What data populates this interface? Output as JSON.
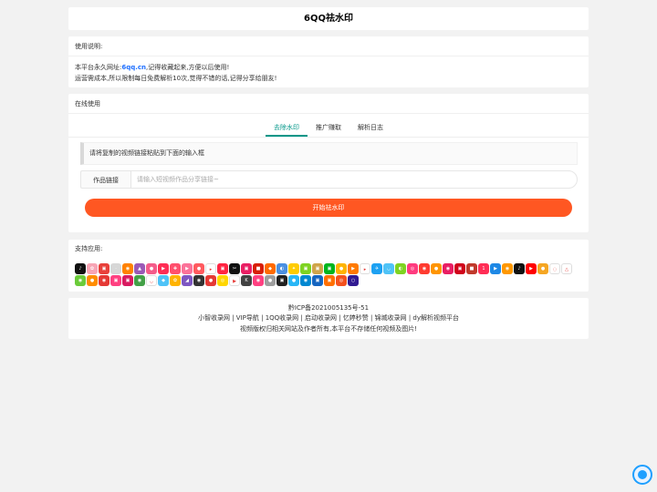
{
  "header": {
    "title": "6QQ祛水印"
  },
  "usage": {
    "heading": "使用说明:",
    "line1_prefix": "本平台永久网址:",
    "line1_site": "6qq.cn",
    "line1_suffix": ",记得收藏起来,方便以后使用!",
    "line2": "运营需成本,所以限制每日免费解析10次,觉得不错的话,记得分享给朋友!"
  },
  "online": {
    "heading": "在线使用",
    "tabs": [
      {
        "label": "去除水印",
        "active": true
      },
      {
        "label": "推广赚取",
        "active": false
      },
      {
        "label": "解析日志",
        "active": false
      }
    ],
    "hint": "请将复制的视频链接粘贴到下面的输入框",
    "field_label": "作品链接",
    "field_placeholder": "请输入短视频作品分享链接~",
    "field_value": "",
    "submit_label": "开始祛水印",
    "accent_color": "#ff5722",
    "tab_active_color": "#009688"
  },
  "apps": {
    "heading": "支持应用:",
    "icons": [
      {
        "name": "douyin-icon",
        "color": "#111111",
        "glyph": "♪"
      },
      {
        "name": "app-icon-2",
        "color": "#f7a5b5",
        "glyph": "✿"
      },
      {
        "name": "app-icon-3",
        "color": "#e8403a",
        "glyph": "▣"
      },
      {
        "name": "app-icon-4",
        "color": "#d7d7d7",
        "glyph": "·"
      },
      {
        "name": "weibo-icon",
        "color": "#ff8200",
        "glyph": "◉"
      },
      {
        "name": "app-icon-6",
        "color": "#9b59b6",
        "glyph": "▲"
      },
      {
        "name": "app-icon-7",
        "color": "#f45c8a",
        "glyph": "●"
      },
      {
        "name": "app-icon-8",
        "color": "#ff2d55",
        "glyph": "▶"
      },
      {
        "name": "app-icon-9",
        "color": "#ff4f6d",
        "glyph": "✚"
      },
      {
        "name": "app-icon-10",
        "color": "#fb7299",
        "glyph": "▶"
      },
      {
        "name": "app-icon-11",
        "color": "#ff5a5f",
        "glyph": "●"
      },
      {
        "name": "app-icon-12",
        "color": "#ffffff",
        "glyph": "▸"
      },
      {
        "name": "app-icon-13",
        "color": "#ff2442",
        "glyph": "▣"
      },
      {
        "name": "app-icon-14",
        "color": "#111111",
        "glyph": "✂"
      },
      {
        "name": "app-icon-15",
        "color": "#e91e63",
        "glyph": "▣"
      },
      {
        "name": "app-icon-16",
        "color": "#d81e06",
        "glyph": "■"
      },
      {
        "name": "app-icon-17",
        "color": "#ff6a00",
        "glyph": "◆"
      },
      {
        "name": "app-icon-18",
        "color": "#4a90e2",
        "glyph": "◐"
      },
      {
        "name": "app-icon-19",
        "color": "#ffcc00",
        "glyph": "✦"
      },
      {
        "name": "app-icon-20",
        "color": "#7ed321",
        "glyph": "▣"
      },
      {
        "name": "app-icon-21",
        "color": "#cfa54a",
        "glyph": "▣"
      },
      {
        "name": "app-icon-22",
        "color": "#00b51d",
        "glyph": "▣"
      },
      {
        "name": "app-icon-23",
        "color": "#ffb400",
        "glyph": "●"
      },
      {
        "name": "app-icon-24",
        "color": "#ff7a00",
        "glyph": "▶"
      },
      {
        "name": "app-icon-25",
        "color": "#ffffff",
        "glyph": "▸"
      },
      {
        "name": "twitter-icon",
        "color": "#1da1f2",
        "glyph": "✈"
      },
      {
        "name": "app-icon-27",
        "color": "#4fc3f7",
        "glyph": "◡"
      },
      {
        "name": "app-icon-28",
        "color": "#7ed321",
        "glyph": "◐"
      },
      {
        "name": "app-icon-29",
        "color": "#ff3b7f",
        "glyph": "◎"
      },
      {
        "name": "app-icon-30",
        "color": "#ff3b30",
        "glyph": "◉"
      },
      {
        "name": "app-icon-31",
        "color": "#ff9500",
        "glyph": "●"
      },
      {
        "name": "app-icon-32",
        "color": "#e91e63",
        "glyph": "◉"
      },
      {
        "name": "app-icon-33",
        "color": "#d0021b",
        "glyph": "▣"
      },
      {
        "name": "app-icon-34",
        "color": "#c0392b",
        "glyph": "■"
      },
      {
        "name": "app-icon-35",
        "color": "#ff2d55",
        "glyph": "1"
      },
      {
        "name": "app-icon-36",
        "color": "#1e88e5",
        "glyph": "▶"
      },
      {
        "name": "app-icon-37",
        "color": "#ff9800",
        "glyph": "◉"
      },
      {
        "name": "app-icon-38",
        "color": "#111111",
        "glyph": "♪"
      },
      {
        "name": "app-icon-39",
        "color": "#ff0000",
        "glyph": "▶"
      },
      {
        "name": "app-icon-40",
        "color": "#f5a623",
        "glyph": "●"
      },
      {
        "name": "app-icon-41",
        "color": "#ffffff",
        "glyph": "◌"
      },
      {
        "name": "app-icon-42",
        "color": "#ffffff",
        "glyph": "△"
      },
      {
        "name": "app-icon-43",
        "color": "#6bcb3a",
        "glyph": "◉"
      },
      {
        "name": "app-icon-44",
        "color": "#ff8c00",
        "glyph": "●"
      },
      {
        "name": "app-icon-45",
        "color": "#e53935",
        "glyph": "◉"
      },
      {
        "name": "app-icon-46",
        "color": "#ff4081",
        "glyph": "▣"
      },
      {
        "name": "app-icon-47",
        "color": "#d81b60",
        "glyph": "▣"
      },
      {
        "name": "app-icon-48",
        "color": "#43a047",
        "glyph": "◉"
      },
      {
        "name": "app-icon-49",
        "color": "#ffffff",
        "glyph": "◡"
      },
      {
        "name": "app-icon-50",
        "color": "#4fc3f7",
        "glyph": "◆"
      },
      {
        "name": "app-icon-51",
        "color": "#ffb300",
        "glyph": "✿"
      },
      {
        "name": "app-icon-52",
        "color": "#7e57c2",
        "glyph": "◢"
      },
      {
        "name": "app-icon-53",
        "color": "#333333",
        "glyph": "◉"
      },
      {
        "name": "app-icon-54",
        "color": "#e53935",
        "glyph": "●"
      },
      {
        "name": "app-icon-55",
        "color": "#ffd600",
        "glyph": "◎"
      },
      {
        "name": "app-icon-56",
        "color": "#ffffff",
        "glyph": "▶"
      },
      {
        "name": "app-icon-57",
        "color": "#424242",
        "glyph": "K"
      },
      {
        "name": "app-icon-58",
        "color": "#ff4081",
        "glyph": "◉"
      },
      {
        "name": "app-icon-59",
        "color": "#9e9e9e",
        "glyph": "●"
      },
      {
        "name": "app-icon-60",
        "color": "#212121",
        "glyph": "▣"
      },
      {
        "name": "app-icon-61",
        "color": "#29b6f6",
        "glyph": "●"
      },
      {
        "name": "app-icon-62",
        "color": "#0288d1",
        "glyph": "◉"
      },
      {
        "name": "app-icon-63",
        "color": "#1565c0",
        "glyph": "▣"
      },
      {
        "name": "app-icon-64",
        "color": "#ff6f00",
        "glyph": "▣"
      },
      {
        "name": "app-icon-65",
        "color": "#f4511e",
        "glyph": "◎"
      },
      {
        "name": "app-icon-66",
        "color": "#311b92",
        "glyph": "○"
      }
    ]
  },
  "footer": {
    "icp": "黔ICP备2021005135号-51",
    "links": [
      "小智收录网",
      "VIP导航",
      "1QQ收录网",
      "启动收录网",
      "忆婷秒赞",
      "锦城收录网",
      "dy解析视频平台"
    ],
    "notice": "视频版权归相关网站及作者所有,本平台不存储任何视频及图片!"
  }
}
